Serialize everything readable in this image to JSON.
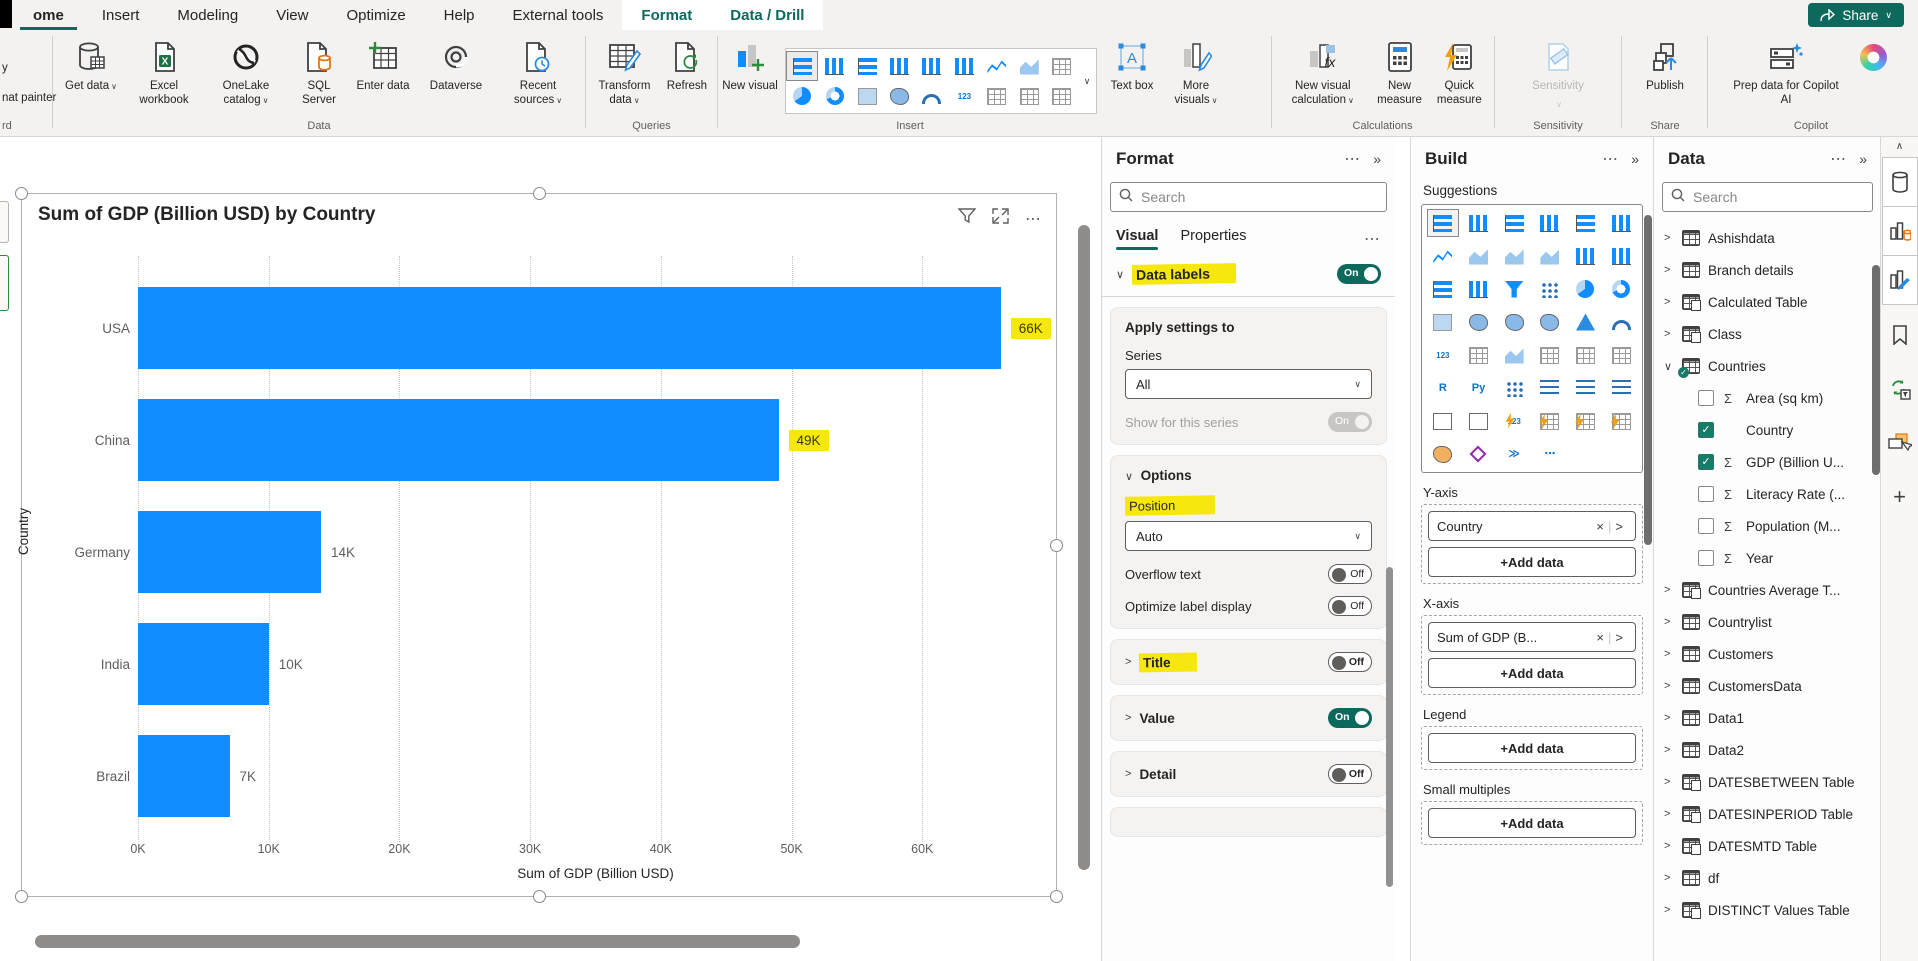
{
  "colors": {
    "accent_teal": "#0c695c",
    "bar_blue": "#118DFF",
    "highlight_yellow": "#f6e70c"
  },
  "menubar": {
    "tabs": [
      {
        "label": "ome",
        "active": true
      },
      {
        "label": "Insert"
      },
      {
        "label": "Modeling"
      },
      {
        "label": "View"
      },
      {
        "label": "Optimize"
      },
      {
        "label": "Help"
      },
      {
        "label": "External tools"
      },
      {
        "label": "Format",
        "contextual": true
      },
      {
        "label": "Data / Drill",
        "contextual": true
      }
    ],
    "share_label": "Share"
  },
  "ribbon": {
    "clipboard_partial": {
      "line1": "y",
      "line2": "nat painter",
      "group_label": "rd"
    },
    "group_labels": [
      "Data",
      "Queries",
      "Insert",
      "Calculations",
      "Sensitivity",
      "Share",
      "Copilot"
    ],
    "buttons": {
      "get_data": "Get data",
      "excel_workbook": "Excel workbook",
      "onelake_catalog": "OneLake catalog",
      "sql_server": "SQL Server",
      "enter_data": "Enter data",
      "dataverse": "Dataverse",
      "recent_sources": "Recent sources",
      "transform_data": "Transform data",
      "refresh": "Refresh",
      "new_visual": "New visual",
      "text_box": "Text box",
      "more_visuals": "More visuals",
      "new_visual_calculation": "New visual calculation",
      "new_measure": "New measure",
      "quick_measure": "Quick measure",
      "sensitivity": "Sensitivity",
      "publish": "Publish",
      "prep_copilot": "Prep data for Copilot AI"
    },
    "gallery_icons": [
      "stacked-bar-chart",
      "clustered-column-chart",
      "clustered-bar-chart",
      "column-chart",
      "line-and-stacked-column-chart",
      "line-and-clustered-column-chart",
      "line-chart",
      "area-chart",
      "slicer",
      "pie-chart",
      "donut-chart",
      "treemap",
      "map",
      "gauge",
      "card",
      "multi-row-card",
      "table",
      "matrix"
    ]
  },
  "chart_data": {
    "type": "bar",
    "orientation": "horizontal",
    "title": "Sum of GDP (Billion USD) by Country",
    "categories": [
      "USA",
      "China",
      "Germany",
      "India",
      "Brazil"
    ],
    "values": [
      66000,
      49000,
      14000,
      10000,
      7000
    ],
    "data_labels": [
      "66K",
      "49K",
      "14K",
      "10K",
      "7K"
    ],
    "highlighted_labels": [
      "66K",
      "49K"
    ],
    "x_ticks": [
      "0K",
      "10K",
      "20K",
      "30K",
      "40K",
      "50K",
      "60K"
    ],
    "xlim": [
      0,
      70000
    ],
    "xlabel": "Sum of GDP (Billion USD)",
    "ylabel": "Country",
    "bar_color": "#118DFF",
    "grid": "dotted-vertical",
    "legend": "none"
  },
  "visual_header_icons": [
    "filter-icon",
    "focus-mode-icon",
    "more-options-icon"
  ],
  "format_pane": {
    "title": "Format",
    "search_placeholder": "Search",
    "tabs": [
      {
        "label": "Visual",
        "active": true
      },
      {
        "label": "Properties"
      }
    ],
    "data_labels": {
      "label": "Data labels",
      "toggle": "On"
    },
    "apply_card": {
      "heading": "Apply settings to",
      "series_label": "Series",
      "series_value": "All",
      "show_series_label": "Show for this series",
      "show_series_toggle": "On"
    },
    "options_card": {
      "heading": "Options",
      "position_label": "Position",
      "position_value": "Auto",
      "overflow_label": "Overflow text",
      "overflow_toggle": "Off",
      "optimize_label": "Optimize label display",
      "optimize_toggle": "Off"
    },
    "title_card": {
      "label": "Title",
      "toggle": "Off"
    },
    "value_card": {
      "label": "Value",
      "toggle": "On"
    },
    "detail_card": {
      "label": "Detail",
      "toggle": "Off"
    }
  },
  "build_pane": {
    "title": "Build",
    "suggestions_label": "Suggestions",
    "suggestions": [
      "stacked-bar-chart",
      "stacked-column-chart",
      "clustered-bar-chart",
      "clustered-column-chart",
      "100-stacked-bar-chart",
      "100-stacked-column-chart",
      "line-chart",
      "area-chart",
      "stacked-area-chart",
      "100-stacked-area-chart",
      "line-and-stacked-column-chart",
      "line-and-clustered-column-chart",
      "ribbon-chart",
      "waterfall-chart",
      "funnel-chart",
      "scatter-chart",
      "pie-chart",
      "donut-chart",
      "treemap",
      "map",
      "filled-map",
      "shape-map",
      "azure-map",
      "gauge",
      "card",
      "multi-row-card",
      "kpi",
      "slicer",
      "table",
      "matrix",
      "r-script-visual",
      "python-visual",
      "key-influencers",
      "decomposition-tree",
      "qa-visual",
      "smart-narrative",
      "metrics",
      "paginated-report",
      "new-card",
      "new-slicer",
      "new-text-slicer",
      "new-list-slicer",
      "arcgis-map",
      "power-apps",
      "power-automate",
      "more-visuals"
    ],
    "wells": [
      {
        "label": "Y-axis",
        "pill": "Country",
        "add": "+Add data"
      },
      {
        "label": "X-axis",
        "pill": "Sum of GDP (B...",
        "add": "+Add data"
      },
      {
        "label": "Legend",
        "add": "+Add data"
      },
      {
        "label": "Small multiples",
        "add": "+Add data"
      }
    ]
  },
  "data_pane": {
    "title": "Data",
    "search_placeholder": "Search",
    "items": [
      {
        "label": "Ashishdata",
        "kind": "table"
      },
      {
        "label": "Branch details",
        "kind": "table"
      },
      {
        "label": "Calculated Table",
        "kind": "calc-table"
      },
      {
        "label": "Class",
        "kind": "calc-table"
      },
      {
        "label": "Countries",
        "kind": "table",
        "expanded": true,
        "badge": true
      },
      {
        "label": "Area (sq km)",
        "kind": "field",
        "sigma": true,
        "checked": false
      },
      {
        "label": "Country",
        "kind": "field",
        "sigma": false,
        "checked": true
      },
      {
        "label": "GDP (Billion U...",
        "kind": "field",
        "sigma": true,
        "checked": true
      },
      {
        "label": "Literacy Rate (...",
        "kind": "field",
        "sigma": true,
        "checked": false
      },
      {
        "label": "Population (M...",
        "kind": "field",
        "sigma": true,
        "checked": false
      },
      {
        "label": "Year",
        "kind": "field",
        "sigma": true,
        "checked": false
      },
      {
        "label": "Countries Average T...",
        "kind": "calc-table"
      },
      {
        "label": "Countrylist",
        "kind": "table"
      },
      {
        "label": "Customers",
        "kind": "table"
      },
      {
        "label": "CustomersData",
        "kind": "table"
      },
      {
        "label": "Data1",
        "kind": "table"
      },
      {
        "label": "Data2",
        "kind": "table"
      },
      {
        "label": "DATESBETWEEN Table",
        "kind": "calc-table"
      },
      {
        "label": "DATESINPERIOD Table",
        "kind": "calc-table"
      },
      {
        "label": "DATESMTD Table",
        "kind": "calc-table"
      },
      {
        "label": "df",
        "kind": "table"
      },
      {
        "label": "DISTINCT Values Table",
        "kind": "calc-table"
      }
    ]
  },
  "rail_icons": [
    "chevron-up-icon",
    "data-pane-icon",
    "build-pane-icon",
    "format-pane-icon",
    "bookmarks-icon",
    "sync-slicers-icon",
    "selection-icon",
    "add-pane-icon"
  ]
}
